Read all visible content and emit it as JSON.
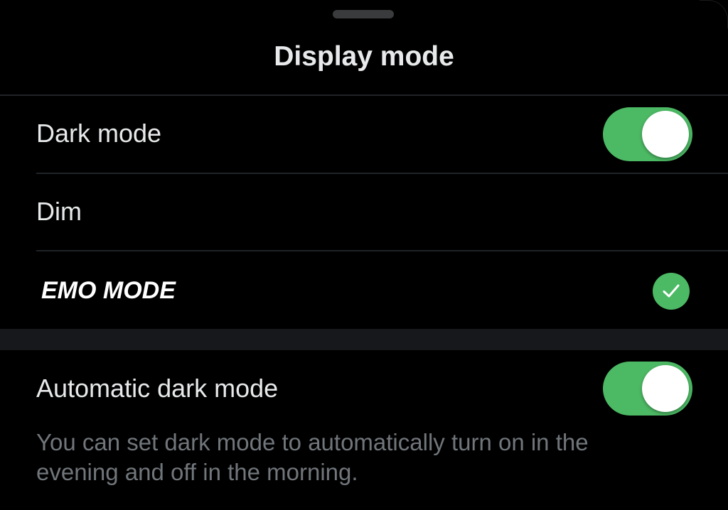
{
  "sheet": {
    "title": "Display mode"
  },
  "rows": {
    "dark_mode": {
      "label": "Dark mode",
      "enabled": true
    },
    "dim": {
      "label": "Dim"
    },
    "emo_mode": {
      "label": "EMO MODE",
      "selected": true
    },
    "automatic": {
      "label": "Automatic dark mode",
      "enabled": true
    }
  },
  "description": "You can set dark mode to automatically turn on in the evening and off in the morning.",
  "colors": {
    "accent": "#4cb964",
    "background": "#000000",
    "text": "#e7e9ea",
    "secondary_text": "#71767b",
    "divider": "#202327"
  },
  "icons": {
    "check": "checkmark-icon",
    "grabber": "sheet-grabber-handle"
  }
}
